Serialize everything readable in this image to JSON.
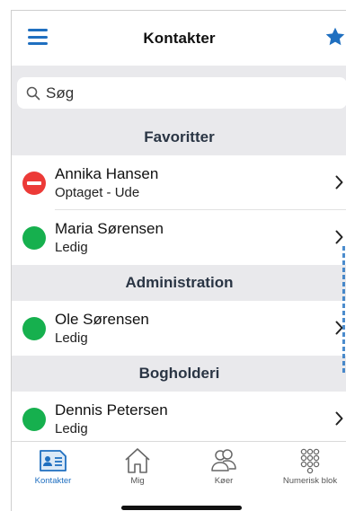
{
  "header": {
    "title": "Kontakter"
  },
  "search": {
    "placeholder": "Søg"
  },
  "sections": [
    {
      "title": "Favoritter",
      "contacts": [
        {
          "name": "Annika Hansen",
          "status": "Optaget - Ude",
          "state": "busy"
        },
        {
          "name": "Maria Sørensen",
          "status": "Ledig",
          "state": "available"
        }
      ]
    },
    {
      "title": "Administration",
      "contacts": [
        {
          "name": "Ole Sørensen",
          "status": "Ledig",
          "state": "available"
        }
      ]
    },
    {
      "title": "Bogholderi",
      "contacts": [
        {
          "name": "Dennis Petersen",
          "status": "Ledig",
          "state": "available"
        }
      ]
    }
  ],
  "tabs": [
    {
      "label": "Kontakter",
      "icon": "contact-card-icon",
      "active": true
    },
    {
      "label": "Mig",
      "icon": "home-icon",
      "active": false
    },
    {
      "label": "Køer",
      "icon": "queue-people-icon",
      "active": false
    },
    {
      "label": "Numerisk blok",
      "icon": "keypad-icon",
      "active": false
    }
  ],
  "colors": {
    "accent": "#1f6fc0",
    "available": "#16b04e",
    "busy": "#ec3a37",
    "section_bg": "#e9e9ec"
  }
}
